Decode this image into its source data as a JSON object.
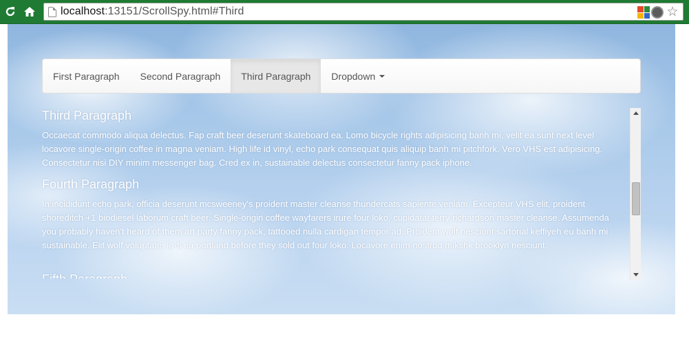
{
  "browser": {
    "url_host": "localhost",
    "url_rest": ":13151/ScrollSpy.html#Third",
    "icons": [
      "reload-icon",
      "home-icon",
      "page-icon",
      "extension-icon",
      "lightbulb-icon",
      "star-icon"
    ]
  },
  "navbar": {
    "items": [
      {
        "label": "First Paragraph",
        "active": false
      },
      {
        "label": "Second Paragraph",
        "active": false
      },
      {
        "label": "Third Paragraph",
        "active": true
      },
      {
        "label": "Dropdown",
        "active": false
      }
    ]
  },
  "content": {
    "third": {
      "title": "Third Paragraph",
      "body": "Occaecat commodo aliqua delectus. Fap craft beer deserunt skateboard ea. Lomo bicycle rights adipisicing banh mi, velit ea sunt next level locavore single-origin coffee in magna veniam. High life id vinyl, echo park consequat quis aliquip banh mi pitchfork. Vero VHS est adipisicing. Consectetur nisi DIY minim messenger bag. Cred ex in, sustainable delectus consectetur fanny pack iphone."
    },
    "fourth": {
      "title": "Fourth Paragraph",
      "body": "In incididunt echo park, officia deserunt mcsweeney's proident master cleanse thundercats sapiente veniam. Excepteur VHS elit, proident shoreditch +1 biodiesel laborum craft beer. Single-origin coffee wayfarers irure four loko, cupidatat terry richardson master cleanse. Assumenda you probably haven't heard of them art party fanny pack, tattooed nulla cardigan tempor ad. Proident wolf nesciunt sartorial keffiyeh eu banh mi sustainable. Elit wolf voluptate, lo-fi ea portland before they sold out four loko. Locavore enim nostrud mlkshk brooklyn nesciunt."
    },
    "fifth": {
      "title": "Fifth Paragraph"
    }
  }
}
